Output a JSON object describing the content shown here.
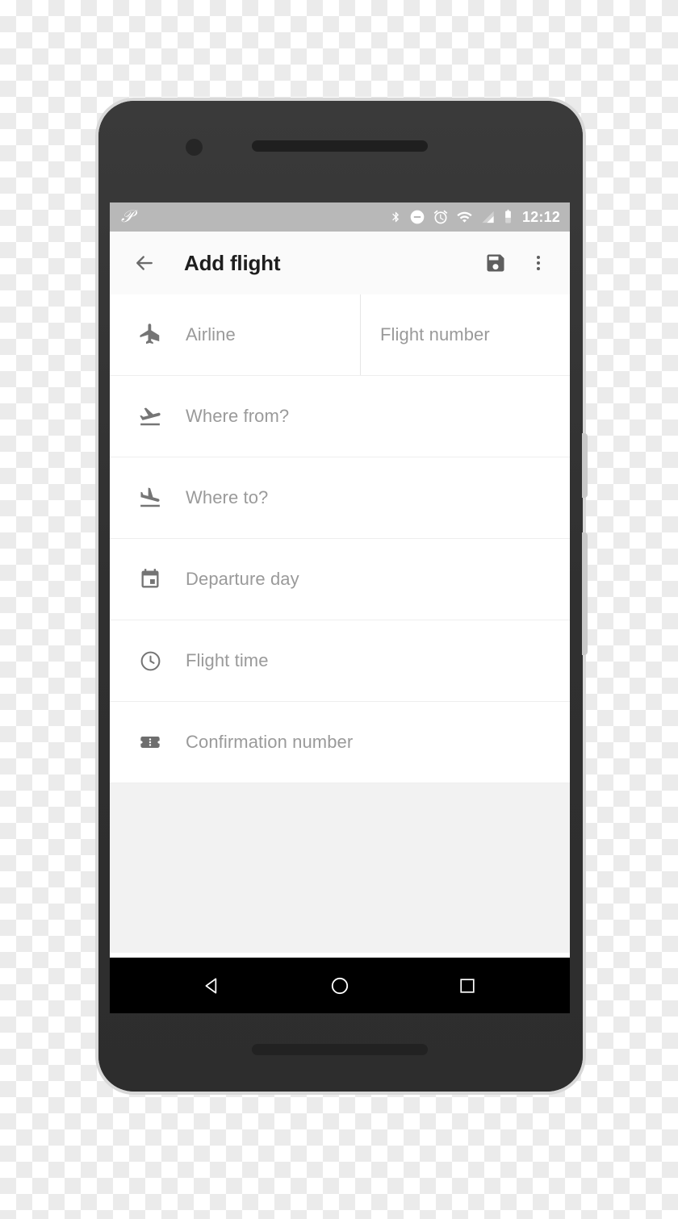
{
  "device": {
    "camera_icon": "camera-dot",
    "earpiece_icon": "earpiece-speaker",
    "bottom_speaker_icon": "bottom-speaker",
    "power_button": "power-button",
    "volume_button": "volume-rocker"
  },
  "status_bar": {
    "notification_icon": "app-notification-p-icon",
    "icons": [
      "bluetooth-icon",
      "do-not-disturb-icon",
      "alarm-icon",
      "wifi-icon",
      "cellular-signal-icon",
      "battery-icon"
    ],
    "time": "12:12",
    "background_color": "#b8b8b8"
  },
  "app_bar": {
    "back_icon": "back-arrow-icon",
    "title": "Add flight",
    "save_icon": "save-floppy-icon",
    "overflow_icon": "overflow-menu-icon",
    "background_color": "#fafafa",
    "title_color": "#1e1e1e"
  },
  "form": {
    "rows": [
      {
        "icon": "airplane-icon",
        "placeholder": "Airline",
        "second_icon": null,
        "second_placeholder": "Flight number",
        "split": true
      },
      {
        "icon": "flight-takeoff-icon",
        "placeholder": "Where from?",
        "split": false
      },
      {
        "icon": "flight-land-icon",
        "placeholder": "Where to?",
        "split": false
      },
      {
        "icon": "calendar-icon",
        "placeholder": "Departure day",
        "split": false
      },
      {
        "icon": "clock-icon",
        "placeholder": "Flight time",
        "split": false
      },
      {
        "icon": "confirmation-ticket-icon",
        "placeholder": "Confirmation number",
        "split": false
      }
    ],
    "placeholder_color": "#9a9a9a",
    "divider_color": "#eeeeee",
    "empty_background_color": "#f2f2f2"
  },
  "nav_bar": {
    "back_icon": "nav-back-triangle-icon",
    "home_icon": "nav-home-circle-icon",
    "recents_icon": "nav-recents-square-icon",
    "background_color": "#000000"
  }
}
